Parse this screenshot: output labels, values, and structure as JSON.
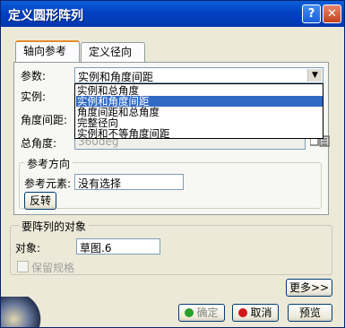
{
  "window": {
    "title": "定义圆形阵列",
    "help_glyph": "?",
    "close_glyph": "✕"
  },
  "tabs": [
    {
      "label": "轴向参考",
      "active": true
    },
    {
      "label": "定义径向",
      "active": false
    }
  ],
  "params": {
    "label": "参数:",
    "selected": "实例和角度间距",
    "options": [
      "实例和总角度",
      "实例和角度间距",
      "角度间距和总角度",
      "完整径向",
      "实例和不等角度间距"
    ],
    "highlighted_index": 1
  },
  "instances_label": "实例:",
  "angle_spacing_label": "角度间距:",
  "total_angle": {
    "label": "总角度:",
    "value": "360deg"
  },
  "reference_direction": {
    "legend": "参考方向",
    "element_label": "参考元素:",
    "element_value": "没有选择",
    "reverse_button": "反转"
  },
  "object_section": {
    "legend": "要阵列的对象",
    "object_label": "对象:",
    "object_value": "草图.6",
    "keep_spec_label": "保留规格"
  },
  "buttons": {
    "more": "更多>>",
    "ok": "确定",
    "cancel": "取消",
    "preview": "预览"
  },
  "colors": {
    "titlebar": "#0241c2",
    "selection": "#316ac5",
    "ok_dot": "#2aa02a",
    "cancel_dot": "#d01818"
  }
}
